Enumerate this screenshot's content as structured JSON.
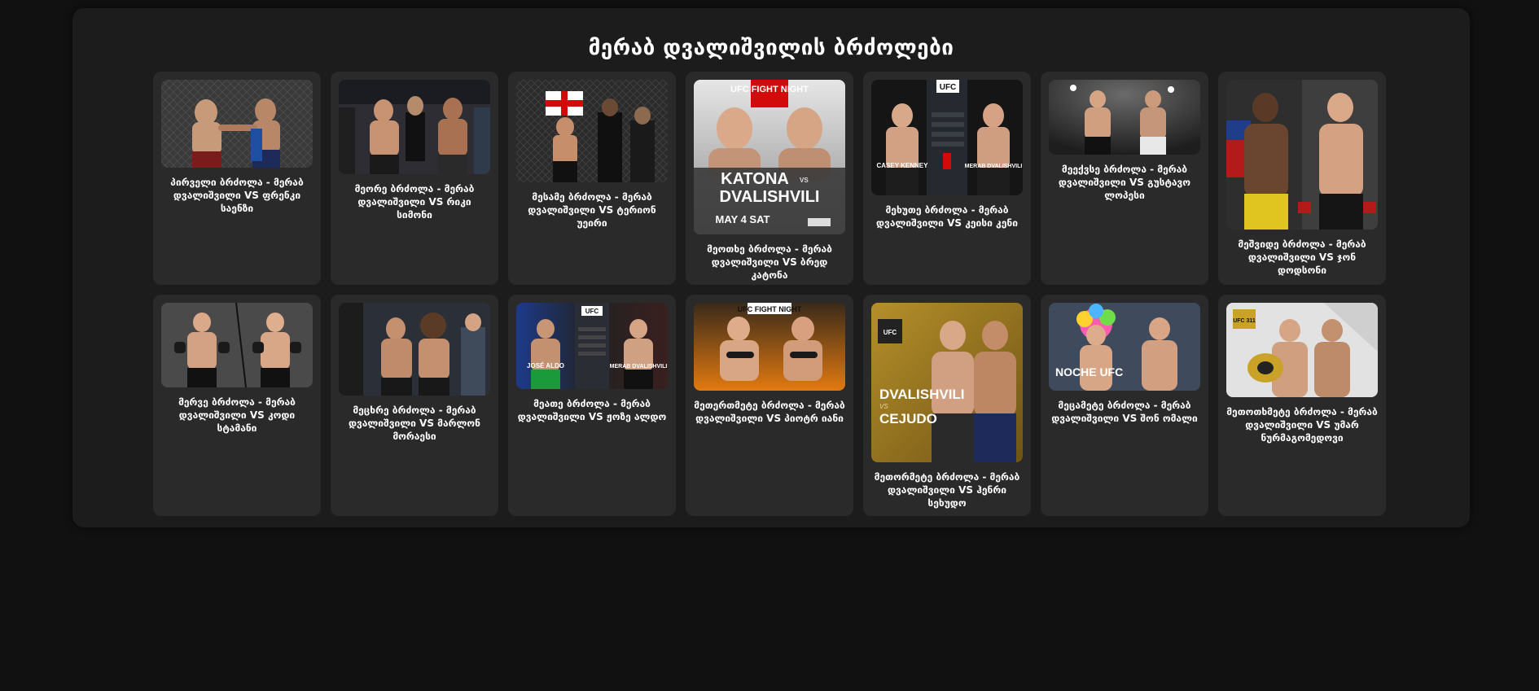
{
  "page": {
    "title": "მერაბ დვალიშვილის ბრძოლები"
  },
  "colors": {
    "background": "#111111",
    "panel": "#1c1c1c",
    "card": "#2a2a2a",
    "ufc_red": "#d20a0a",
    "gold": "#c9a227"
  },
  "fights": [
    {
      "caption": "პირველი ბრძოლა - მერაბ დვალიშვილი VS ფრენკი საენზი"
    },
    {
      "caption": "მეორე ბრძოლა - მერაბ დვალიშვილი VS რიკი სიმონი"
    },
    {
      "caption": "მესამე ბრძოლა - მერაბ დვალიშვილი VS ტერიონ უეირი"
    },
    {
      "caption": "მეოთხე ბრძოლა - მერაბ დვალიშვილი VS ბრედ კატონა",
      "poster_text": {
        "badge": "UFC FIGHT NIGHT",
        "name1": "KATONA",
        "vs": "VS",
        "name2": "DVALISHVILI",
        "date": "MAY 4 SAT"
      }
    },
    {
      "caption": "მეხუთე ბრძოლა - მერაბ დვალიშვილი VS კეისი კენი",
      "poster_text": {
        "badge": "UFC",
        "name1": "CASEY KENNEY",
        "name2": "MERAB DVALISHVILI"
      }
    },
    {
      "caption": "მეექვსე ბრძოლა - მერაბ დვალიშვილი VS გუსტავო ლოპესი"
    },
    {
      "caption": "მეშვიდე ბრძოლა - მერაბ დვალიშვილი VS ჯონ დოდსონი"
    },
    {
      "caption": "მერვე ბრძოლა - მერაბ დვალიშვილი VS კოდი სტამანი"
    },
    {
      "caption": "მეცხრე ბრძოლა - მერაბ დვალიშვილი VS მარლონ მორაესი"
    },
    {
      "caption": "მეათე ბრძოლა - მერაბ დვალიშვილი VS ჟოზე ალდო",
      "poster_text": {
        "badge": "UFC",
        "name1": "JOSÉ ALDO",
        "name2": "MERAB DVALISHVILI"
      }
    },
    {
      "caption": "მეთერთმეტე ბრძოლა - მერაბ დვალიშვილი VS პიოტრ იანი",
      "poster_text": {
        "badge": "UFC FIGHT NIGHT"
      }
    },
    {
      "caption": "მეთორმეტე ბრძოლა - მერაბ დვალიშვილი VS ჰენრი სეხუდო",
      "poster_text": {
        "badge": "UFC",
        "name1": "DVALISHVILI",
        "vs": "VS",
        "name2": "CEJUDO"
      }
    },
    {
      "caption": "მეცამეტე ბრძოლა - მერაბ დვალიშვილი VS შონ ომალი",
      "poster_text": {
        "badge": "NOCHE UFC"
      }
    },
    {
      "caption": "მეთოთხმეტე ბრძოლა - მერაბ დვალიშვილი VS უმარ ნურმაგომედოვი",
      "poster_text": {
        "badge": "UFC 311"
      }
    }
  ]
}
